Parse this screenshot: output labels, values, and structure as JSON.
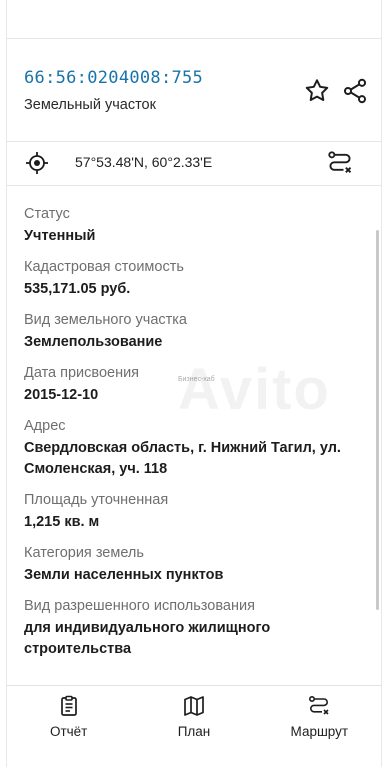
{
  "header": {
    "cadastral_number": "66:56:0204008:755",
    "subtitle": "Земельный участок"
  },
  "coords": {
    "text": "57°53.48'N, 60°2.33'E"
  },
  "properties": [
    {
      "label": "Статус",
      "value": "Учтенный"
    },
    {
      "label": "Кадастровая стоимость",
      "value": "535,171.05 руб."
    },
    {
      "label": "Вид земельного участка",
      "value": "Землепользование"
    },
    {
      "label": "Дата присвоения",
      "value": "2015-12-10"
    },
    {
      "label": "Адрес",
      "value": "Свердловская область, г. Нижний Тагил, ул. Смоленская, уч. 118"
    },
    {
      "label": "Площадь уточненная",
      "value": "1,215 кв. м"
    },
    {
      "label": "Категория земель",
      "value": "Земли населенных пунктов"
    },
    {
      "label": "Вид разрешенного использования",
      "value": "для индивидуального жилищного строительства"
    }
  ],
  "watermark": {
    "big": "Avito",
    "small": "Бизнес-хаб"
  },
  "tabs": [
    {
      "label": "Отчёт",
      "icon": "clipboard-icon"
    },
    {
      "label": "План",
      "icon": "map-icon"
    },
    {
      "label": "Маршрут",
      "icon": "route-icon"
    }
  ]
}
